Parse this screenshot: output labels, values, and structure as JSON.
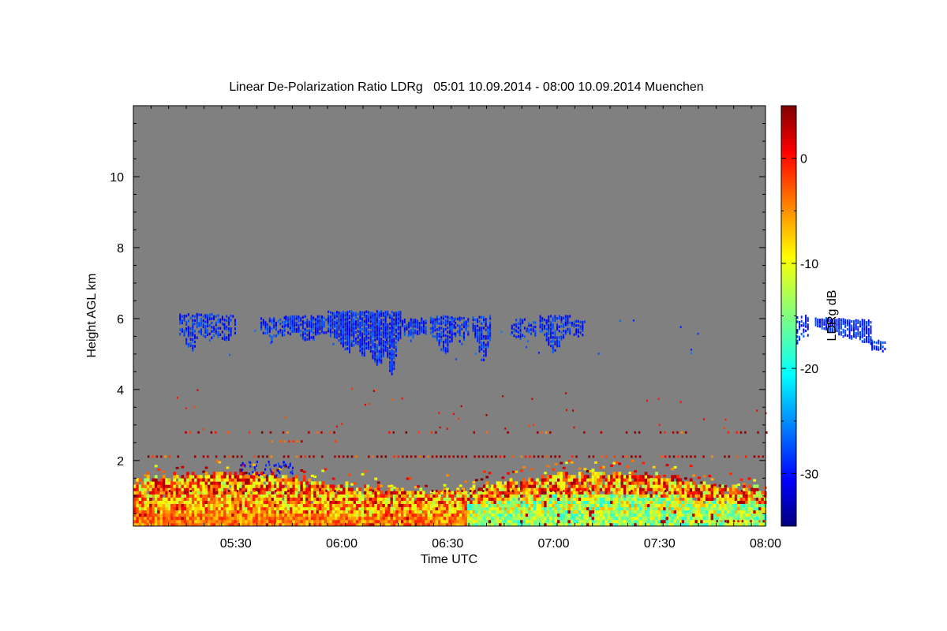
{
  "chart_data": {
    "type": "heatmap",
    "title": "Linear De-Polarization Ratio LDRg   05:01 10.09.2014 - 08:00 10.09.2014 Muenchen",
    "xlabel": "Time UTC",
    "ylabel": "Height AGL km",
    "xlim": [
      "05:01",
      "08:00"
    ],
    "ylim": [
      0.15,
      12
    ],
    "x_ticks": [
      "05:30",
      "06:00",
      "06:30",
      "07:00",
      "07:30",
      "08:00"
    ],
    "y_ticks": [
      "2",
      "4",
      "6",
      "8",
      "10"
    ],
    "colorbar": {
      "label": "LDRg dB",
      "range": [
        -35,
        5
      ],
      "ticks": [
        "0",
        "-10",
        "-20",
        "-30"
      ],
      "colormap": "jet"
    },
    "background_color": "#808080",
    "features": [
      {
        "kind": "ice cloud",
        "time_range": [
          "05:05",
          "06:15"
        ],
        "height_range_km": [
          4.3,
          6.2
        ],
        "ldr_db": -30
      },
      {
        "kind": "ice cloud",
        "time_range": [
          "06:15",
          "06:35"
        ],
        "height_range_km": [
          5.3,
          6.1
        ],
        "ldr_db": -30
      },
      {
        "kind": "ice cloud",
        "time_range": [
          "07:05",
          "07:45"
        ],
        "height_range_km": [
          4.8,
          6.1
        ],
        "ldr_db": -30
      },
      {
        "kind": "boundary layer aerosol",
        "time_range": [
          "05:01",
          "08:00"
        ],
        "height_range_km": [
          0.15,
          1.6
        ],
        "ldr_db": [
          -25,
          3
        ]
      },
      {
        "kind": "insect echoes",
        "time_range": [
          "05:15",
          "08:00"
        ],
        "height_range_km": [
          2.0,
          2.9
        ],
        "ldr_db": 2
      }
    ]
  }
}
